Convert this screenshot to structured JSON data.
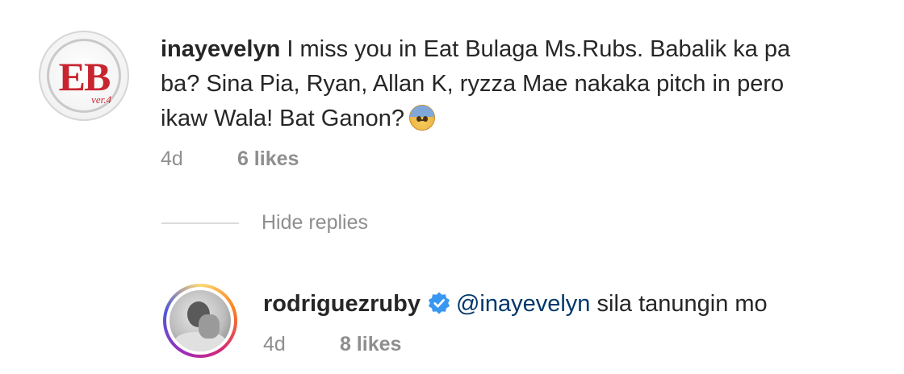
{
  "comment": {
    "avatar_logo": "EB",
    "avatar_badge": "ver.4",
    "username": "inayevelyn",
    "text_line1": "I miss you in Eat Bulaga Ms.Rubs. Babalik ka pa",
    "text_line2": "ba? Sina Pia, Ryan, Allan K, ryzza Mae nakaka pitch in pero",
    "text_line3": "ikaw Wala! Bat Ganon?",
    "emoji": "anxious-face-with-sweat",
    "time": "4d",
    "likes": "6 likes"
  },
  "hide_replies": "Hide replies",
  "reply": {
    "username": "rodriguezruby",
    "verified": "verified-badge-icon",
    "mention": "@inayevelyn",
    "text": " sila tanungin mo",
    "time": "4d",
    "likes": "8 likes"
  },
  "colors": {
    "text": "#262626",
    "secondary": "#8e8e8e",
    "mention": "#00376b",
    "verified": "#3897f0",
    "eb_red": "#c8242f"
  }
}
